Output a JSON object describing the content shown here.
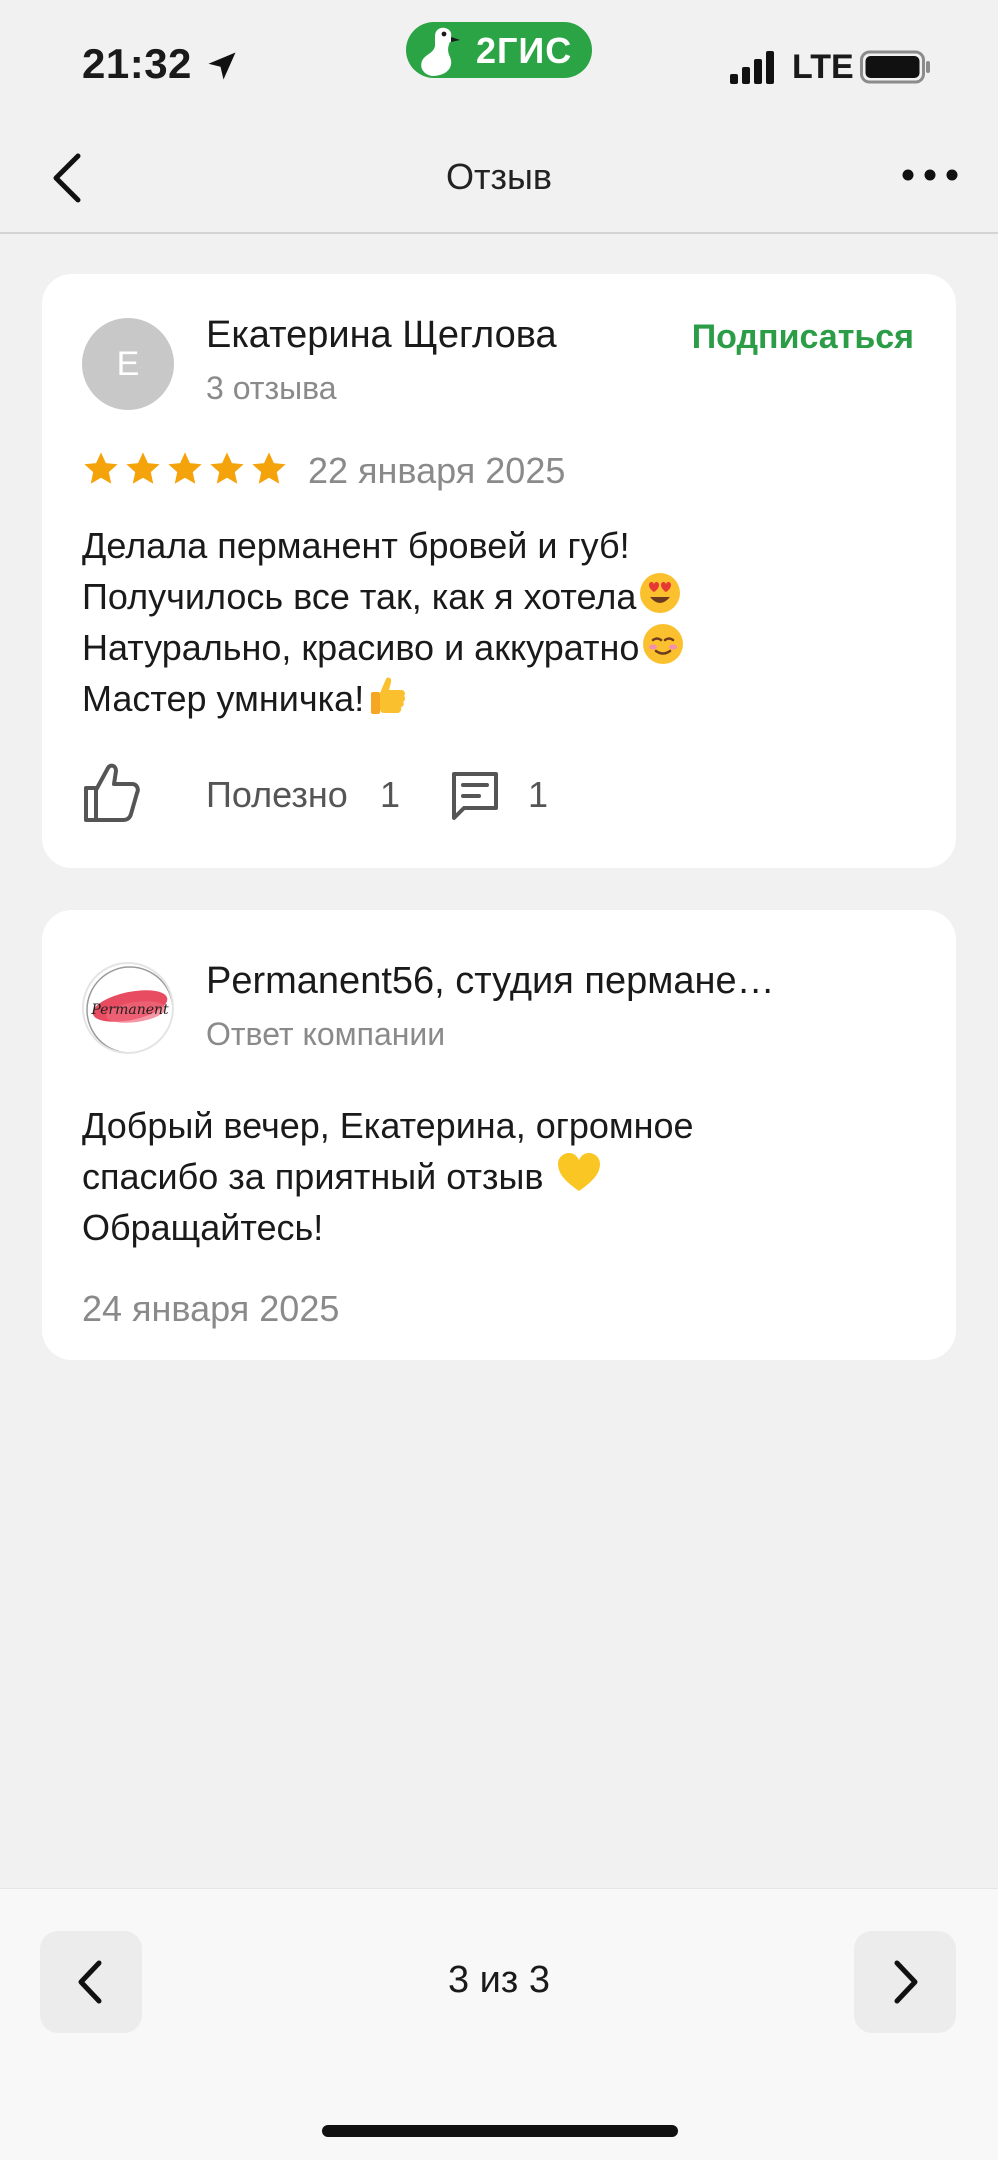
{
  "status_bar": {
    "time": "21:32",
    "brand": "2ГИС",
    "network": "LTE",
    "icons": [
      "location-arrow-icon",
      "signal-bars-icon",
      "battery-icon"
    ]
  },
  "nav": {
    "title": "Отзыв",
    "icons": [
      "chevron-left-icon",
      "more-dots-icon"
    ]
  },
  "review": {
    "avatar_letter": "Е",
    "author": "Екатерина Щеглова",
    "author_reviews": "3 отзыва",
    "subscribe_label": "Подписаться",
    "rating": 5,
    "date": "22 января 2025",
    "lines": [
      "Делала перманент бровей и губ!",
      "Получилось все так, как я хотела",
      "Натурально, красиво и аккуратно",
      "Мастер умничка!"
    ],
    "line_emojis": [
      "",
      "heart-eyes-emoji",
      "smiling-face-emoji",
      "thumbs-up-emoji"
    ],
    "useful_label": "Полезно",
    "useful_count": "1",
    "comments_count": "1"
  },
  "reply": {
    "logo_text": "Permanent",
    "company": "Permanent56, студия пермане…",
    "subtitle": "Ответ компании",
    "lines": [
      "Добрый вечер, Екатерина, огромное",
      "спасибо за приятный отзыв",
      "Обращайтесь!"
    ],
    "line_emojis": [
      "",
      "yellow-heart-emoji",
      ""
    ],
    "date": "24 января 2025"
  },
  "pager": {
    "text": "3 из 3",
    "icons": [
      "chevron-left-icon",
      "chevron-right-icon"
    ]
  },
  "colors": {
    "brand_green": "#2aa444",
    "subscribe_green": "#2a9d46",
    "star": "#f4a30b",
    "background": "#f1f1f1",
    "card": "#ffffff",
    "muted_text": "#8a8a8a"
  }
}
